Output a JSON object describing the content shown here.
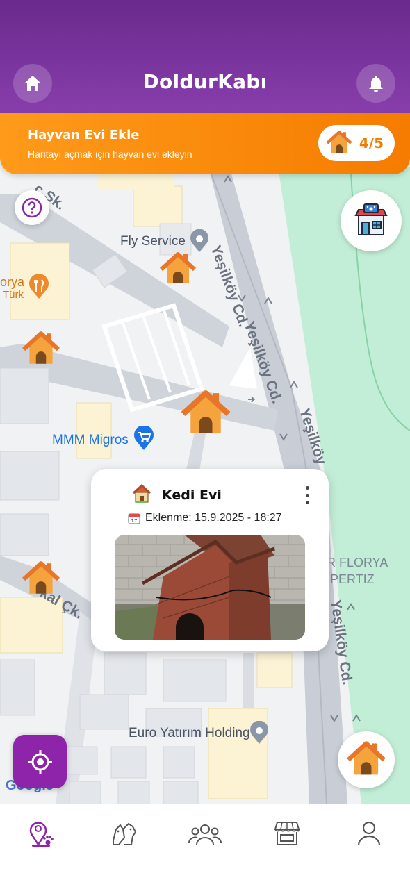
{
  "app": {
    "title": "DoldurKabı"
  },
  "header": {
    "home_icon": "home-icon",
    "bell_icon": "bell-icon"
  },
  "banner": {
    "title": "Hayvan Evi Ekle",
    "subtitle": "Haritayı açmak için hayvan evi ekleyin",
    "counter": "4/5"
  },
  "map": {
    "roads": [
      "Yeşilköy Cd.",
      "Yeşilköy Cd.",
      "Yeşilköy",
      "Yeşilköy Cd.",
      "ç Sk.",
      "kal Çk."
    ],
    "pois": {
      "fly_service": "Fly Service",
      "migros": "MMM Migros",
      "florya_left_1": "orya",
      "florya_left_2": "Türk",
      "florya_right_1": "R FLORYA",
      "florya_right_2": "PERTIZ",
      "euro": "Euro Yatırım Holding",
      "google": "Google"
    }
  },
  "popup": {
    "title": "Kedi Evi",
    "date": "Eklenme: 15.9.2025 - 18:27"
  },
  "nav": {
    "items": [
      "map-paw",
      "pets",
      "community",
      "shop",
      "profile"
    ],
    "active": "map-paw"
  },
  "colors": {
    "primary": "#8e24aa",
    "header": "#7b35a0",
    "accent": "#f57c00",
    "park": "#bfeed2"
  }
}
